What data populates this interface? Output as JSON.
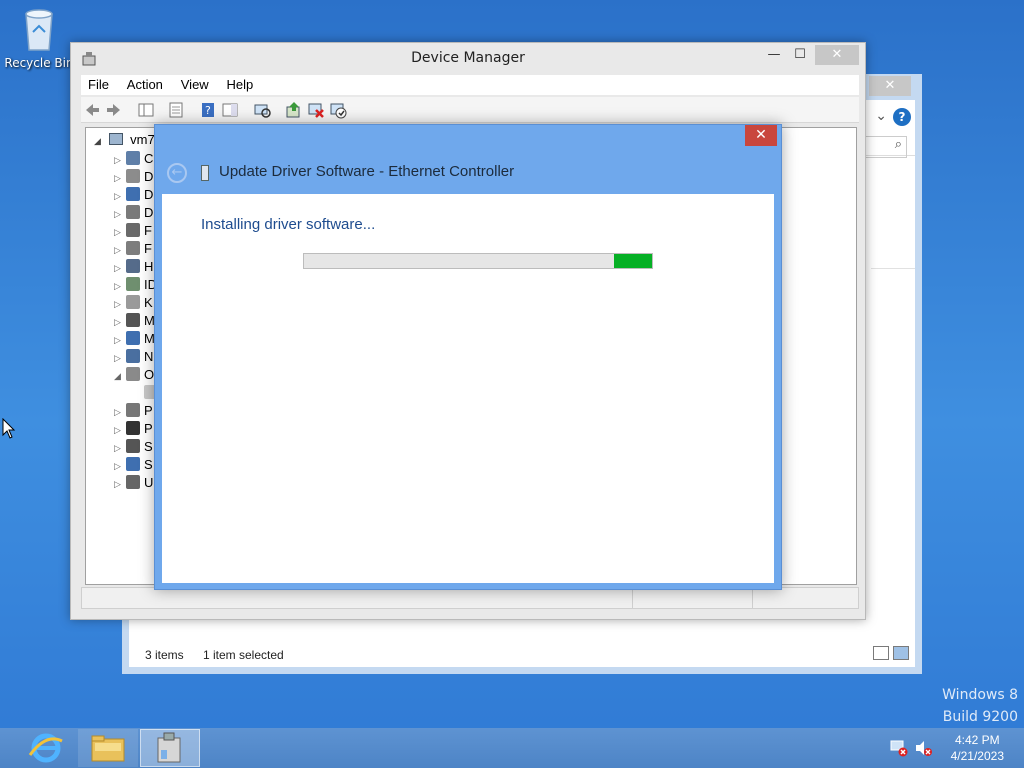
{
  "desktop": {
    "recycle_bin_label": "Recycle Bin",
    "watermark_line1": "Windows 8",
    "watermark_line2": "Build 9200"
  },
  "explorer": {
    "close_glyph": "✕",
    "help_glyph": "?",
    "chevron_glyph": "⌄",
    "search_glyph": "⌕",
    "status_items": "3 items",
    "status_selected": "1 item selected"
  },
  "device_manager": {
    "title": "Device Manager",
    "minimize_glyph": "—",
    "maximize_glyph": "☐",
    "close_glyph": "✕",
    "menu": [
      "File",
      "Action",
      "View",
      "Help"
    ],
    "tree_root": "vm7",
    "tree_items": [
      {
        "expanded": false,
        "initial": "C"
      },
      {
        "expanded": false,
        "initial": "D"
      },
      {
        "expanded": false,
        "initial": "D"
      },
      {
        "expanded": false,
        "initial": "D"
      },
      {
        "expanded": false,
        "initial": "F"
      },
      {
        "expanded": false,
        "initial": "F"
      },
      {
        "expanded": false,
        "initial": "H"
      },
      {
        "expanded": false,
        "initial": "ID"
      },
      {
        "expanded": false,
        "initial": "K"
      },
      {
        "expanded": false,
        "initial": "M"
      },
      {
        "expanded": false,
        "initial": "M"
      },
      {
        "expanded": false,
        "initial": "N"
      },
      {
        "expanded": true,
        "initial": "O"
      },
      {
        "expanded": false,
        "initial": "",
        "child": true
      },
      {
        "expanded": false,
        "initial": "P"
      },
      {
        "expanded": false,
        "initial": "P"
      },
      {
        "expanded": false,
        "initial": "S"
      },
      {
        "expanded": false,
        "initial": "S"
      },
      {
        "expanded": false,
        "initial": "U"
      }
    ]
  },
  "dialog": {
    "title": "Update Driver Software - Ethernet Controller",
    "heading": "Installing driver software...",
    "close_glyph": "✕",
    "back_glyph": "←",
    "progress_fraction": 1.0,
    "progress_indicator_start": 0.89,
    "progress_color": "#06b025"
  },
  "taskbar": {
    "time": "4:42 PM",
    "date": "4/21/2023",
    "buttons": [
      "internet-explorer",
      "file-explorer",
      "device-manager"
    ]
  }
}
